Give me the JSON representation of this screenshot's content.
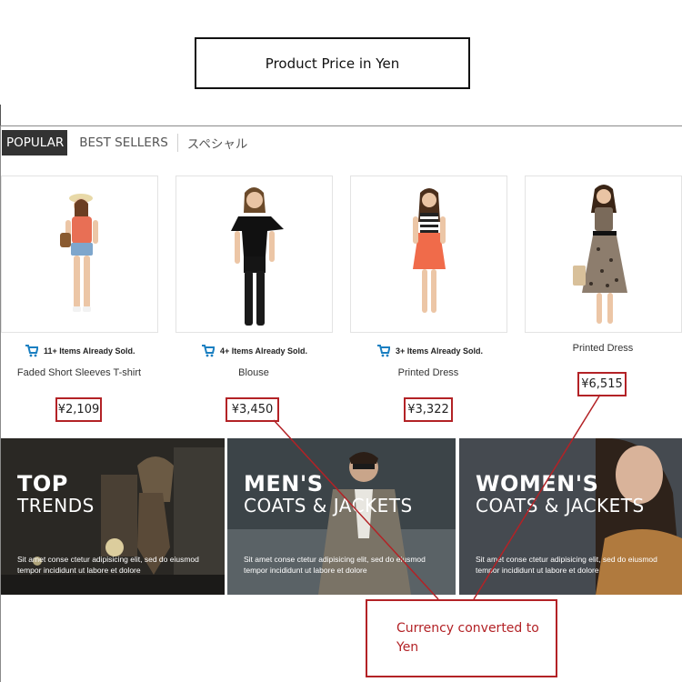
{
  "callout_top": {
    "label": "Product Price in Yen"
  },
  "tabs": [
    {
      "label": "POPULAR",
      "active": true
    },
    {
      "label": "BEST SELLERS",
      "active": false
    },
    {
      "label": "スペシャル",
      "active": false
    }
  ],
  "products": [
    {
      "sold": "11+ Items Already Sold.",
      "name": "Faded Short Sleeves T-shirt",
      "price": "¥2,109"
    },
    {
      "sold": "4+ Items Already Sold.",
      "name": "Blouse",
      "price": "¥3,450"
    },
    {
      "sold": "3+ Items Already Sold.",
      "name": "Printed Dress",
      "price": "¥3,322"
    },
    {
      "sold": "",
      "name": "Printed Dress",
      "price": "¥6,515"
    }
  ],
  "banners": [
    {
      "title1": "TOP",
      "title2": "TRENDS",
      "text": "Sit amet conse ctetur adipisicing elit, sed do eiusmod tempor incididunt ut labore et dolore"
    },
    {
      "title1": "MEN'S",
      "title2": "COATS & JACKETS",
      "text": "Sit amet conse ctetur adipisicing elit, sed do eiusmod tempor incididunt ut labore et dolore"
    },
    {
      "title1": "WOMEN'S",
      "title2": "COATS & JACKETS",
      "text": "Sit amet conse ctetur adipisicing elit, sed do eiusmod tempor incididunt ut labore et dolore"
    }
  ],
  "callout_bottom": {
    "line1": "Currency converted to",
    "line2": "Yen"
  },
  "colors": {
    "accent_red": "#b32226",
    "cart_blue": "#1a7fc1",
    "tab_active": "#333333"
  }
}
